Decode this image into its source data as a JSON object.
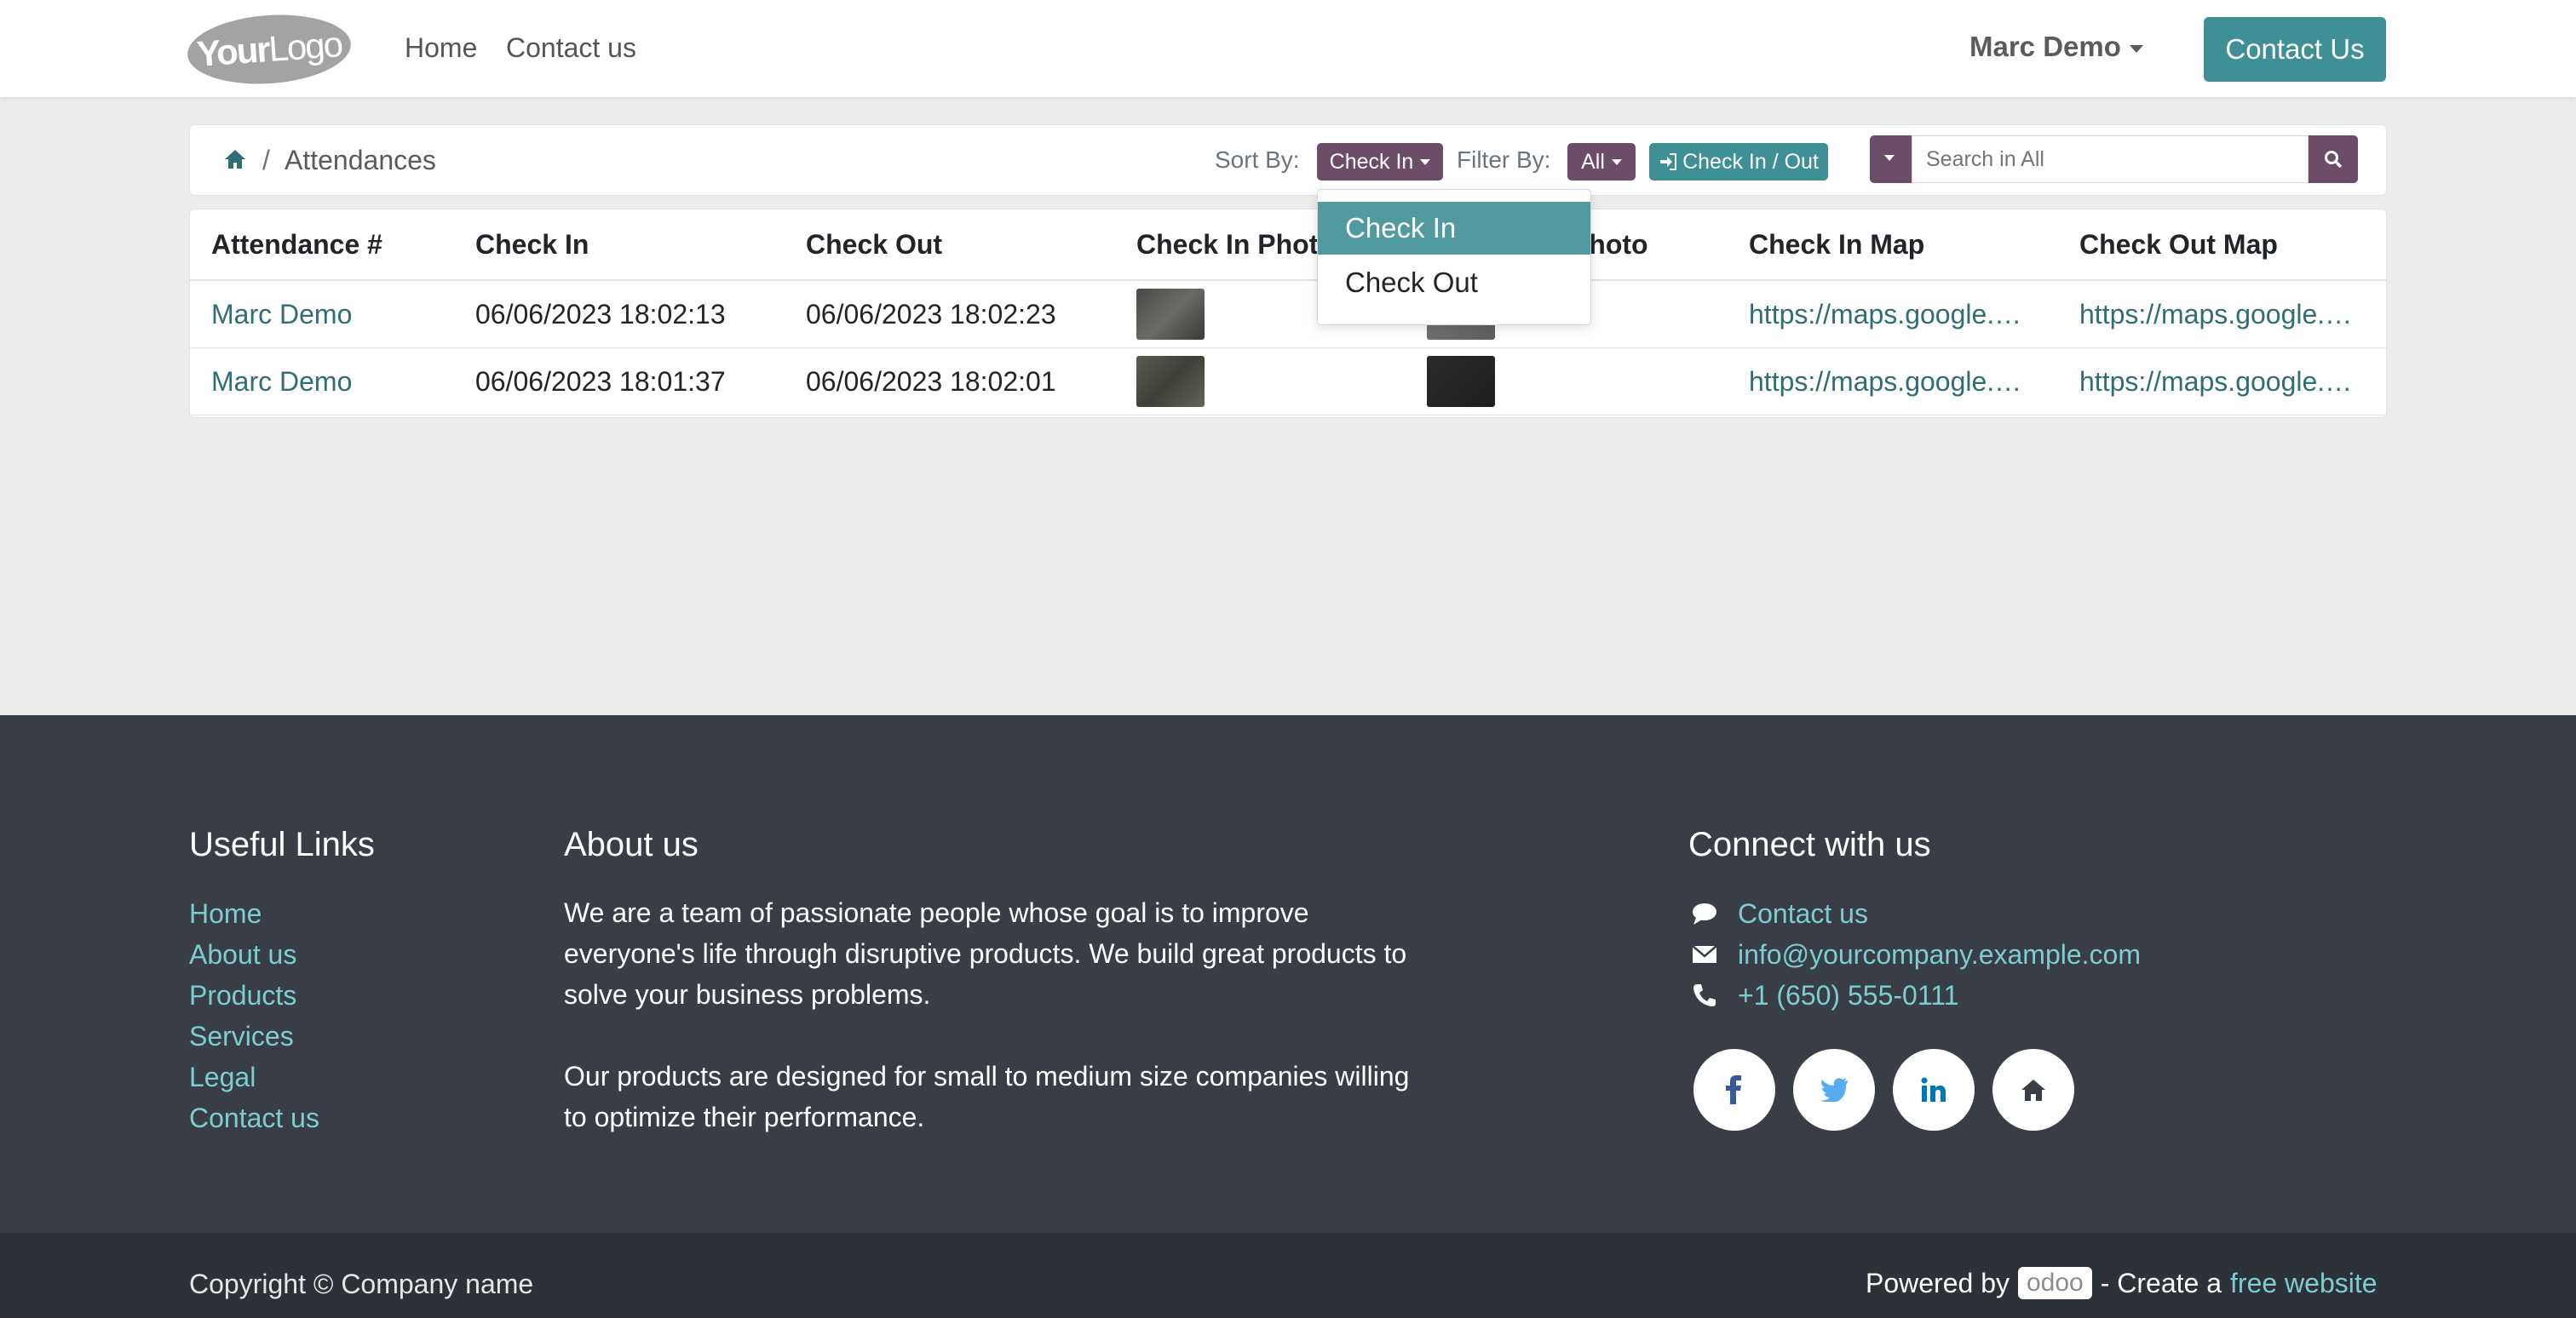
{
  "header": {
    "logo_text_bold": "Your",
    "logo_text_light": "Logo",
    "nav": [
      "Home",
      "Contact us"
    ],
    "user": "Marc Demo",
    "cta": "Contact Us"
  },
  "breadcrumb": {
    "current": "Attendances",
    "separator": "/"
  },
  "controls": {
    "sort_label": "Sort By:",
    "sort_value": "Check In",
    "filter_label": "Filter By:",
    "filter_value": "All",
    "checkin_btn": "Check In / Out",
    "search_placeholder": "Search in All"
  },
  "dropdown": {
    "items": [
      "Check In",
      "Check Out"
    ],
    "selected": "Check In"
  },
  "table": {
    "columns": [
      "Attendance #",
      "Check In",
      "Check Out",
      "Check In Photo",
      "Check Out Photo",
      "Check In Map",
      "Check Out Map"
    ],
    "rows": [
      {
        "name": "Marc Demo",
        "check_in": "06/06/2023 18:02:13",
        "check_out": "06/06/2023 18:02:23",
        "in_map": "https://maps.google.…",
        "out_map": "https://maps.google.…"
      },
      {
        "name": "Marc Demo",
        "check_in": "06/06/2023 18:01:37",
        "check_out": "06/06/2023 18:02:01",
        "in_map": "https://maps.google.…",
        "out_map": "https://maps.google.…"
      }
    ]
  },
  "footer": {
    "useful_links_title": "Useful Links",
    "useful_links": [
      "Home",
      "About us",
      "Products",
      "Services",
      "Legal",
      "Contact us"
    ],
    "about_title": "About us",
    "about_p1_l1": "We are a team of passionate people whose goal is to improve",
    "about_p1_l2": "everyone's life through disruptive products. We build great products to",
    "about_p1_l3": "solve your business problems.",
    "about_p2_l1": "Our products are designed for small to medium size companies willing",
    "about_p2_l2": "to optimize their performance.",
    "connect_title": "Connect with us",
    "contact_link": "Contact us",
    "email": "info@yourcompany.example.com",
    "phone": "+1 (650) 555-0111",
    "copyright": "Copyright © Company name",
    "powered_by": "Powered by",
    "odoo": "odoo",
    "create_a": "- Create a",
    "free_website": "free website"
  },
  "colors": {
    "accent": "#3f8f96",
    "brand_purple": "#6b4d67",
    "footer_bg": "#393e46",
    "link": "#2f6e74"
  }
}
